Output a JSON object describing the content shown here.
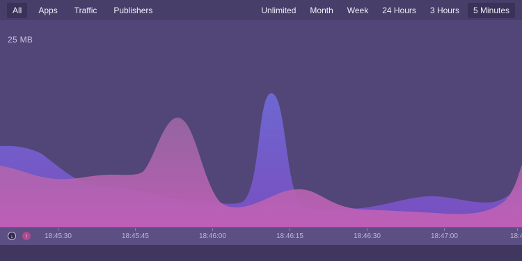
{
  "nav": {
    "filters": [
      "All",
      "Apps",
      "Traffic",
      "Publishers"
    ],
    "active_filter": "All",
    "ranges": [
      "Unlimited",
      "Month",
      "Week",
      "24 Hours",
      "3 Hours",
      "5 Minutes"
    ],
    "active_range": "5 Minutes"
  },
  "chart": {
    "scale_label": "25 MB"
  },
  "timeline": {
    "ticks": [
      "18:45:30",
      "18:45:45",
      "18:46:00",
      "18:46:15",
      "18:46:30",
      "18:47:00",
      "18:4"
    ]
  },
  "legend": {
    "download_icon": "download-arrow-icon",
    "upload_icon": "upload-arrow-icon"
  },
  "colors": {
    "background": "#514677",
    "topbar": "#483e6a",
    "download_series": "#7a6ed6",
    "upload_series": "#b86dae"
  }
}
